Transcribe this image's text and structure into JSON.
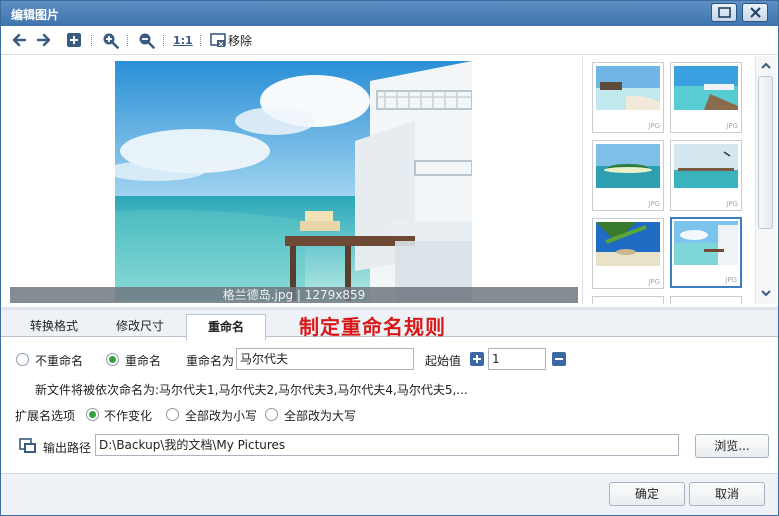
{
  "window": {
    "title": "编辑图片"
  },
  "toolbar": {
    "one_to_one": "1:1",
    "remove_label": "移除"
  },
  "preview": {
    "caption": "格兰德岛.jpg | 1279x859"
  },
  "thumbnails": {
    "ext": "JPG"
  },
  "tabs": [
    {
      "label": "转换格式"
    },
    {
      "label": "修改尺寸"
    },
    {
      "label": "重命名"
    }
  ],
  "annotation": "制定重命名规则",
  "rename": {
    "no_rename_label": "不重命名",
    "rename_label": "重命名",
    "rename_as_label": "重命名为",
    "rename_as_value": "马尔代夫",
    "start_label": "起始值",
    "start_value": "1",
    "preview_text": "新文件将被依次命名为:马尔代夫1,马尔代夫2,马尔代夫3,马尔代夫4,马尔代夫5,..."
  },
  "extension": {
    "label": "扩展名选项",
    "no_change": "不作变化",
    "lower": "全部改为小写",
    "upper": "全部改为大写"
  },
  "output": {
    "label": "输出路径",
    "path": "D:\\Backup\\我的文档\\My Pictures",
    "browse": "浏览..."
  },
  "footer": {
    "ok": "确定",
    "cancel": "取消"
  }
}
